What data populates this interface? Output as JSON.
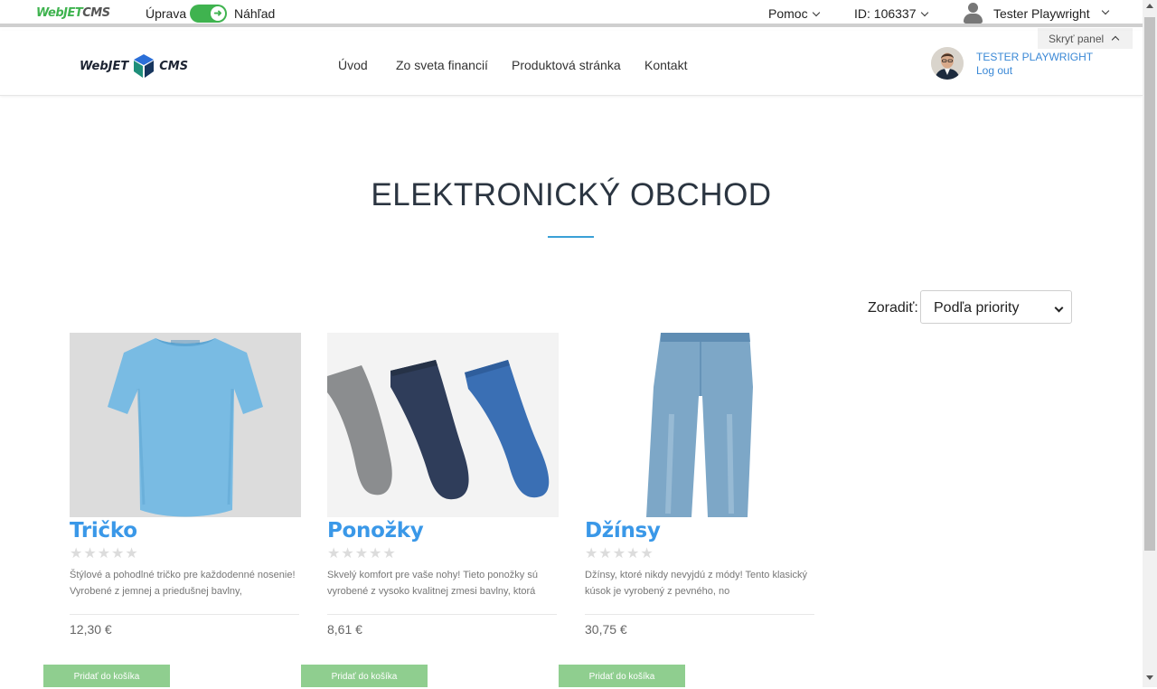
{
  "adminbar": {
    "logo_text_green": "WebJET",
    "logo_text_gray": "CMS",
    "edit_label": "Úprava",
    "preview_label": "Náhľad",
    "help_label": "Pomoc",
    "page_id_label": "ID: 106337",
    "user_label": "Tester Playwright",
    "hide_panel_label": "Skryť panel"
  },
  "site_header": {
    "logo_left": "WebJET",
    "logo_right": "CMS",
    "nav": [
      "Úvod",
      "Zo sveta financií",
      "Produktová stránka",
      "Kontakt"
    ],
    "user_name": "TESTER PLAYWRIGHT",
    "logout_label": "Log out"
  },
  "main": {
    "title": "ELEKTRONICKÝ OBCHOD",
    "sort_label": "Zoradiť:",
    "sort_selected": "Podľa priority",
    "products": [
      {
        "name": "Tričko",
        "rating": 0,
        "stars": "★★★★★",
        "description": "Štýlové a pohodlné tričko pre každodenné nosenie! Vyrobené z jemnej a priedušnej bavlny,",
        "price": "12,30 €",
        "cart_label": "Pridať do košíka"
      },
      {
        "name": "Ponožky",
        "rating": 0,
        "stars": "★★★★★",
        "description": "Skvelý komfort pre vaše nohy! Tieto ponožky sú vyrobené z vysoko kvalitnej zmesi bavlny, ktorá",
        "price": "8,61 €",
        "cart_label": "Pridať do košíka"
      },
      {
        "name": "Džínsy",
        "rating": 0,
        "stars": "★★★★★",
        "description": "Džínsy, ktoré nikdy nevyjdú z módy! Tento klasický kúsok je vyrobený z pevného, no",
        "price": "30,75 €",
        "cart_label": "Pridať do košíka"
      }
    ]
  },
  "colors": {
    "accent_green": "#3fb34f",
    "link_blue": "#3a88d6",
    "product_name_blue": "#3a98e8",
    "cart_button_green": "#8fce8f"
  }
}
